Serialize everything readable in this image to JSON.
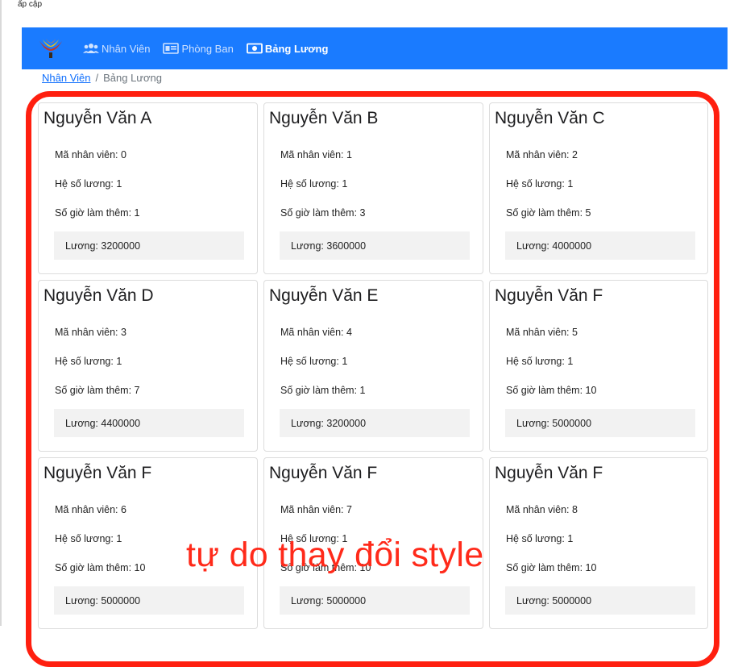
{
  "page": {
    "top_text": "ấp cập"
  },
  "navbar": {
    "bg_color": "#1a7bff",
    "items": [
      {
        "label": "Nhân Viên",
        "icon": "users-icon",
        "active": false
      },
      {
        "label": "Phòng Ban",
        "icon": "id-card-icon",
        "active": false
      },
      {
        "label": "Bảng Lương",
        "icon": "money-icon",
        "active": true
      }
    ]
  },
  "breadcrumb": {
    "link": "Nhân Viên",
    "separator": "/",
    "current": "Bảng Lương"
  },
  "cards": [
    {
      "name": "Nguyễn Văn A",
      "id_text": "Mã nhân viên: 0",
      "coef_text": "Hệ số lương: 1",
      "overtime_text": "Số giờ làm thêm: 1",
      "salary_text": "Lương: 3200000"
    },
    {
      "name": "Nguyễn Văn B",
      "id_text": "Mã nhân viên: 1",
      "coef_text": "Hệ số lương: 1",
      "overtime_text": "Số giờ làm thêm: 3",
      "salary_text": "Lương: 3600000"
    },
    {
      "name": "Nguyễn Văn C",
      "id_text": "Mã nhân viên: 2",
      "coef_text": "Hệ số lương: 1",
      "overtime_text": "Số giờ làm thêm: 5",
      "salary_text": "Lương: 4000000"
    },
    {
      "name": "Nguyễn Văn D",
      "id_text": "Mã nhân viên: 3",
      "coef_text": "Hệ số lương: 1",
      "overtime_text": "Số giờ làm thêm: 7",
      "salary_text": "Lương: 4400000"
    },
    {
      "name": "Nguyễn Văn E",
      "id_text": "Mã nhân viên: 4",
      "coef_text": "Hệ số lương: 1",
      "overtime_text": "Số giờ làm thêm: 1",
      "salary_text": "Lương: 3200000"
    },
    {
      "name": "Nguyễn Văn F",
      "id_text": "Mã nhân viên: 5",
      "coef_text": "Hệ số lương: 1",
      "overtime_text": "Số giờ làm thêm: 10",
      "salary_text": "Lương: 5000000"
    },
    {
      "name": "Nguyễn Văn F",
      "id_text": "Mã nhân viên: 6",
      "coef_text": "Hệ số lương: 1",
      "overtime_text": "Số giờ làm thêm: 10",
      "salary_text": "Lương: 5000000"
    },
    {
      "name": "Nguyễn Văn F",
      "id_text": "Mã nhân viên: 7",
      "coef_text": "Hệ số lương: 1",
      "overtime_text": "Số giờ làm thêm: 10",
      "salary_text": "Lương: 5000000"
    },
    {
      "name": "Nguyễn Văn F",
      "id_text": "Mã nhân viên: 8",
      "coef_text": "Hệ số lương: 1",
      "overtime_text": "Số giờ làm thêm: 10",
      "salary_text": "Lương: 5000000"
    }
  ],
  "annotation": {
    "text": "tự do thay đổi style",
    "color": "#ff2a1a",
    "outline_color": "#ff1f0f"
  }
}
